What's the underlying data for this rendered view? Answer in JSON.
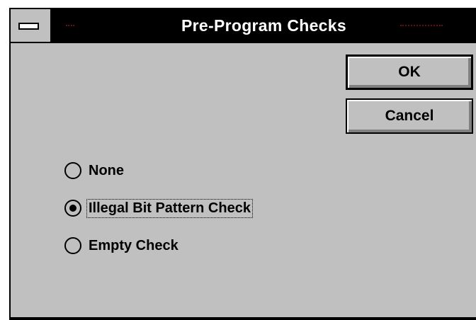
{
  "window": {
    "title": "Pre-Program Checks"
  },
  "buttons": {
    "ok_label": "OK",
    "cancel_label": "Cancel"
  },
  "options": [
    {
      "label": "None",
      "checked": false
    },
    {
      "label": "Illegal Bit Pattern Check",
      "checked": true,
      "focused": true
    },
    {
      "label": "Empty Check",
      "checked": false
    }
  ],
  "colors": {
    "face": "#c0c0c0",
    "titlebar": "#000000",
    "title_text": "#ffffff"
  },
  "icons": {
    "system_menu": "system-menu-icon"
  }
}
